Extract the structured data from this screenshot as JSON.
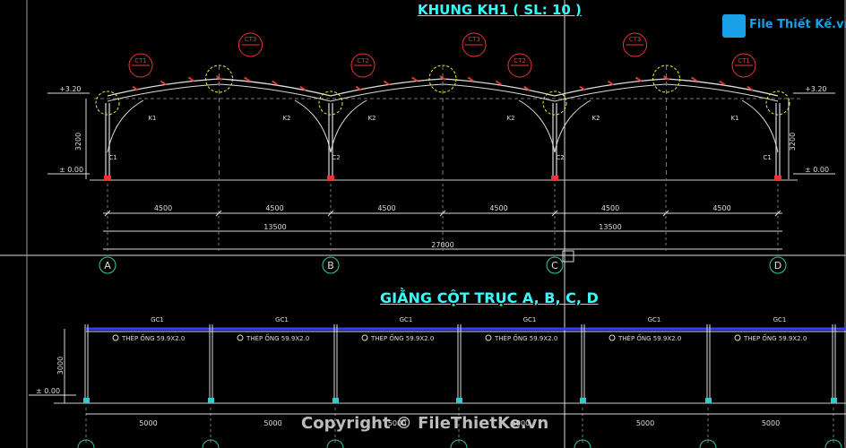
{
  "title_frame": "KHUNG KH1 ( SL: 10 )",
  "title_bracing": "GIẰNG CỘT TRỤC A, B, C, D",
  "logo_text": "File Thiết Kế.vn",
  "copyright": "Copyright © FileThietKe.vn",
  "elevations": {
    "top": "+3.20",
    "base": "± 0.00"
  },
  "height_dim": "3200",
  "bracing_height_dim": "3000",
  "grid_labels": [
    "A",
    "B",
    "C",
    "D"
  ],
  "span_dims": [
    "4500",
    "4500",
    "4500",
    "4500",
    "4500",
    "4500"
  ],
  "mid_dims": [
    "13500",
    "13500"
  ],
  "total_dim": "27000",
  "column_tags": [
    "C1",
    "C2",
    "C2",
    "C1"
  ],
  "knee_tags": [
    "K1",
    "K2",
    "K2",
    "K2",
    "K2",
    "K1"
  ],
  "ridge_tags": [
    "CT3",
    "CT3",
    "CT3"
  ],
  "eave_tags": [
    "CT1",
    "CT2",
    "CT2",
    "CT1"
  ],
  "bay_labels": [
    "GC1",
    "GC1",
    "GC1",
    "GC1",
    "GC1",
    "GC1"
  ],
  "pipe_label": "THÉP ỐNG 59.9X2.0",
  "bay_dims": [
    "5000",
    "5000",
    "5000",
    "5000",
    "5000",
    "5000"
  ]
}
